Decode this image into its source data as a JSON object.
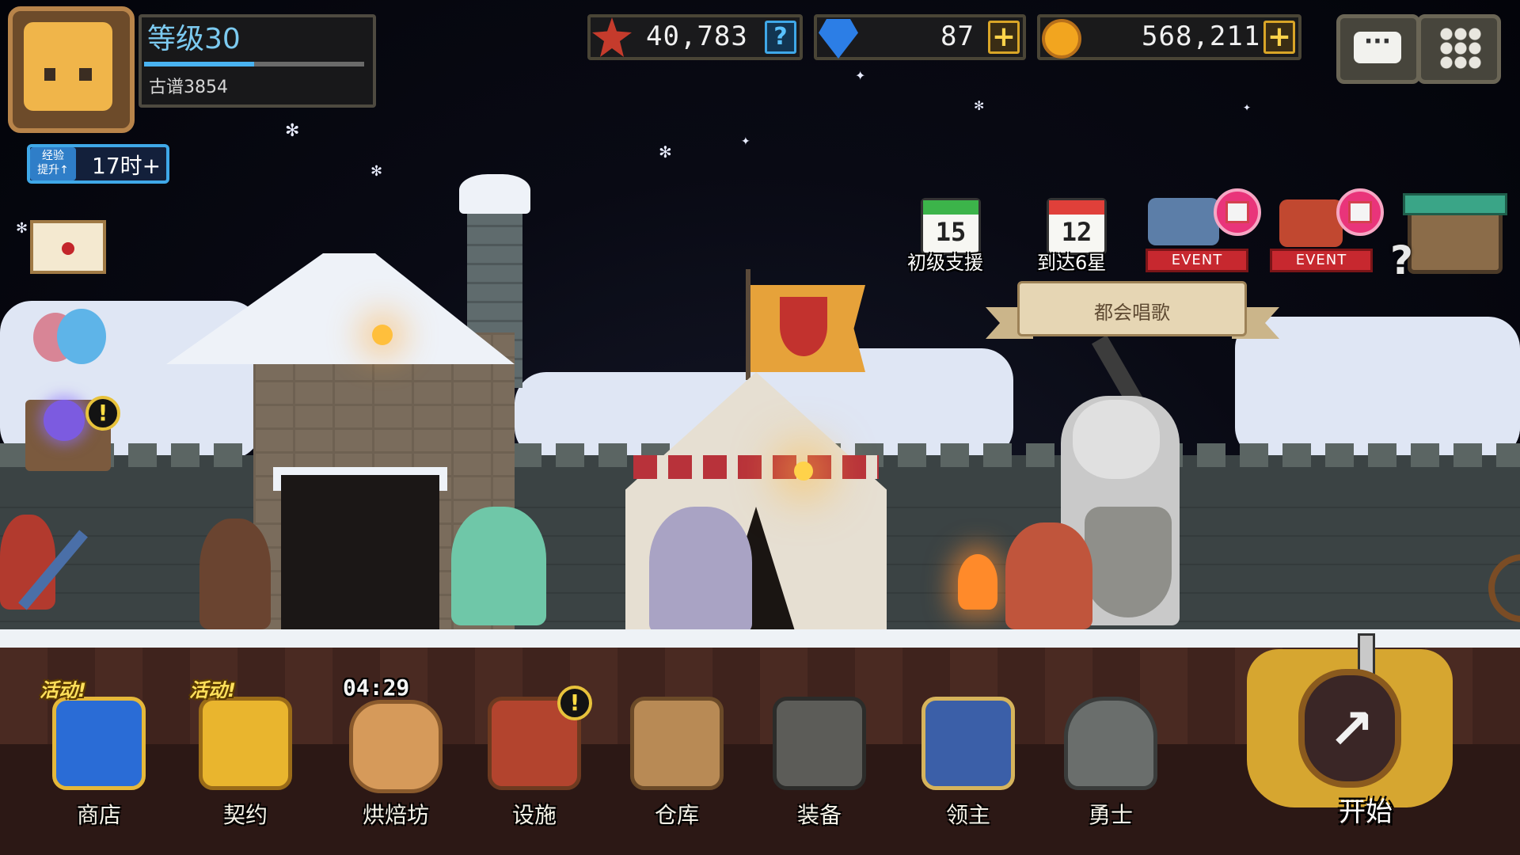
{
  "player": {
    "level_label": "等级30",
    "nickname": "古谱3854",
    "xp_progress": 0.5
  },
  "xp_boost": {
    "icon_text": "经验\n提升↑",
    "timer": "17时+"
  },
  "resources": {
    "medals": {
      "icon": "medal-icon",
      "value": "40,783",
      "help_label": "?"
    },
    "gems": {
      "icon": "gem-icon",
      "value": "87",
      "add_label": "+"
    },
    "gold": {
      "icon": "coin-icon",
      "value": "568,211",
      "add_label": "+"
    }
  },
  "top_buttons": {
    "chat_icon": "chat-bubble-icon",
    "chat_glyph": "···",
    "menu_icon": "grid-menu-icon"
  },
  "side_icons": {
    "mail": "envelope-icon",
    "friends": "friends-icon",
    "quest_book": "magic-book-icon",
    "alert_glyph": "!"
  },
  "events": [
    {
      "id": "support",
      "calendar_number": "15",
      "label": "初级支援",
      "calendar_color": "#3cb44a"
    },
    {
      "id": "stars",
      "calendar_number": "12",
      "label": "到达6星",
      "calendar_color": "#e0403a"
    },
    {
      "id": "event1",
      "banner": "EVENT"
    },
    {
      "id": "event2",
      "banner": "EVENT"
    }
  ],
  "notice_banner": "都会唱歌",
  "board_help_glyph": "?",
  "menu": [
    {
      "label": "商店",
      "tag": "活动!",
      "icon": "shop-gem-icon"
    },
    {
      "label": "契约",
      "tag": "活动!",
      "icon": "contract-scroll-icon"
    },
    {
      "label": "烘焙坊",
      "timer": "04:29",
      "icon": "bakery-bread-icon"
    },
    {
      "label": "设施",
      "alert": "!",
      "icon": "facility-house-icon"
    },
    {
      "label": "仓库",
      "icon": "warehouse-barn-icon"
    },
    {
      "label": "装备",
      "icon": "equipment-icon"
    },
    {
      "label": "领主",
      "icon": "lord-icon"
    },
    {
      "label": "勇士",
      "icon": "warrior-helmet-icon"
    }
  ],
  "start": {
    "label": "开始",
    "glyph": "↗"
  },
  "colors": {
    "accent_blue": "#49b3f1",
    "gold": "#d9a527",
    "event_red": "#c7282f"
  }
}
